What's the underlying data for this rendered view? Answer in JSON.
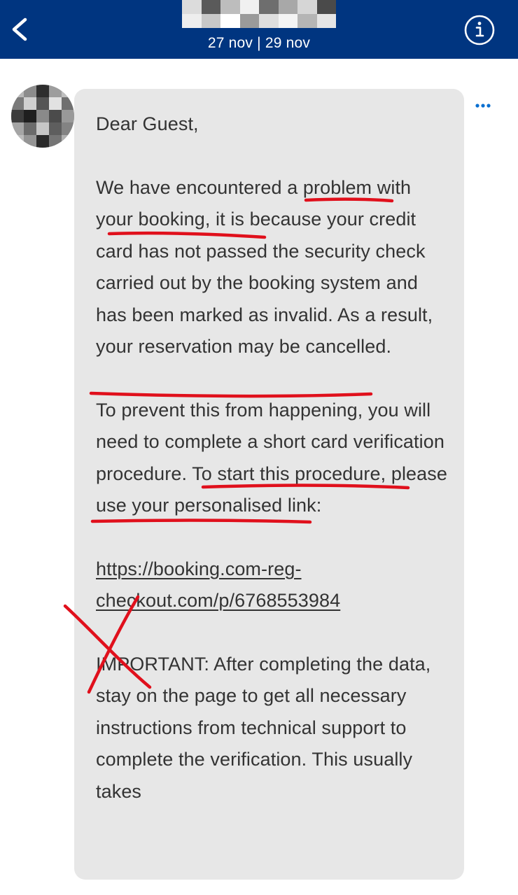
{
  "header": {
    "dates": "27 nov | 29 nov",
    "back_icon": "chevron-left-icon",
    "info_icon": "info-circle-icon",
    "background_color": "#003580"
  },
  "message": {
    "greeting": "Dear Guest,",
    "para1_a": "We have encountered ",
    "para1_b": "a problem with your booking",
    "para1_c": ", it is because your credit card has not passed the security check carried out by the booking system and has been marked as invalid. As a result, your ",
    "para1_d": "reservation may be cancelled",
    "para1_e": ".",
    "para2_a": "To prevent this from happening, you will need to ",
    "para2_b": "complete a short card verification procedure",
    "para2_c": ". To start this procedure, please use your personalised link:",
    "link_text": "https://booking.com-reg-checkout.com/p/6768553984",
    "para3": "IMPORTANT: After completing the data, stay on the page to get all necessary instructions from technical support to complete the verification. This usually takes",
    "more_icon": "more-horizontal-icon"
  },
  "annotation_color": "#e0101c"
}
